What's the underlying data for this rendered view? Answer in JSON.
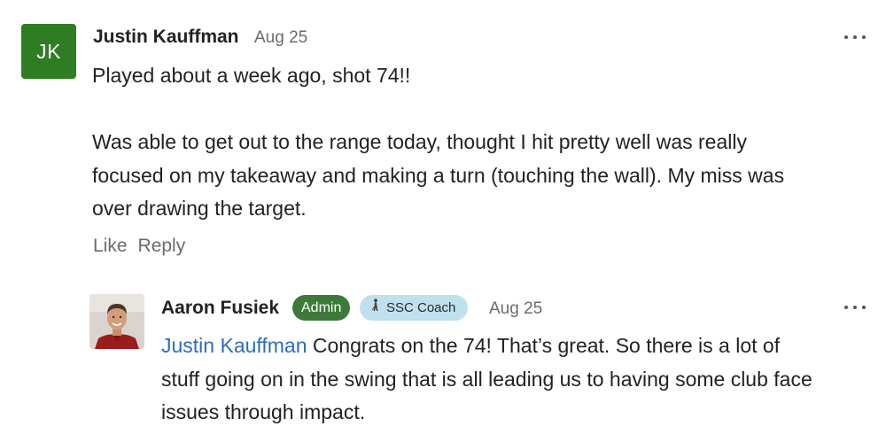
{
  "comment": {
    "avatar_initials": "JK",
    "author": "Justin Kauffman",
    "date": "Aug 25",
    "paragraphs": [
      "Played about a week ago, shot 74!!",
      "Was able to get out to the range today, thought I hit pretty well was really focused on my takeaway and making a turn (touching the wall). My miss was over drawing the target."
    ],
    "like_label": "Like",
    "reply_label": "Reply",
    "avatar_color": "#2f7d22"
  },
  "reply": {
    "author": "Aaron Fusiek",
    "badges": {
      "admin": "Admin",
      "coach": "SSC Coach"
    },
    "date": "Aug 25",
    "mention": "Justin Kauffman",
    "text": " Congrats on the 74!  That’s great.  So there is a lot of stuff going on in the swing that is all leading us to having some club face issues through impact.",
    "admin_badge_color": "#3d7a3a",
    "coach_badge_color": "#bfe0ef",
    "mention_color": "#2d6cc0"
  }
}
